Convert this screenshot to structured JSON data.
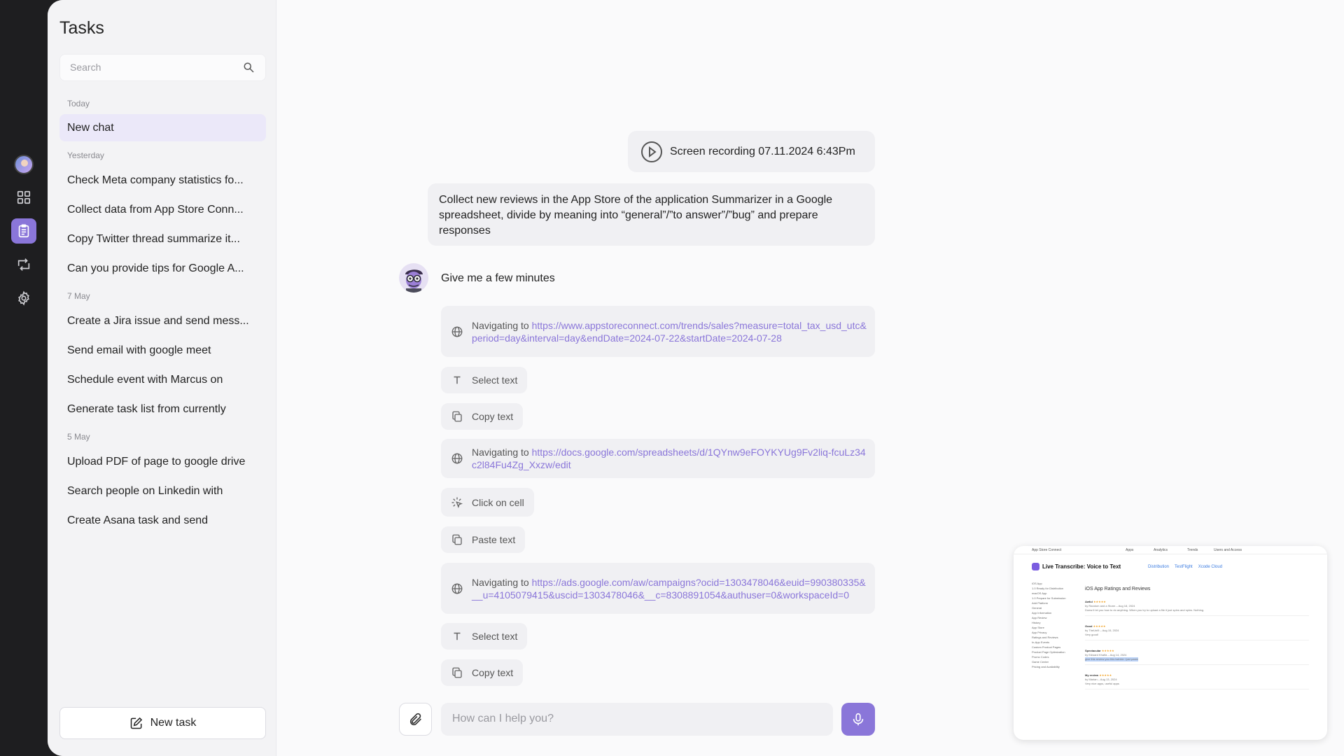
{
  "sidebar": {
    "title": "Tasks",
    "search_placeholder": "Search",
    "sections": [
      {
        "label": "Today",
        "items": [
          "New chat"
        ]
      },
      {
        "label": "Yesterday",
        "items": [
          "Check Meta company statistics fo...",
          "Collect data from App Store Conn...",
          "Copy Twitter thread summarize it...",
          "Can you provide tips for Google A..."
        ]
      },
      {
        "label": "7 May",
        "items": [
          "Create a Jira issue and send mess...",
          "Send email with google meet",
          "Schedule event with Marcus on",
          "Generate task list from currently"
        ]
      },
      {
        "label": "5 May",
        "items": [
          "Upload PDF of page to google drive",
          "Search people on Linkedin with",
          "Create Asana task and send"
        ]
      }
    ],
    "new_task_label": "New task"
  },
  "chat": {
    "recording_label": "Screen recording 07.11.2024 6:43Pm",
    "user_message": "Collect new reviews in the App Store of the application Summarizer in a Google spreadsheet, divide by meaning into “general”/”to answer”/”bug” and prepare responses",
    "bot_reply": "Give me a few minutes",
    "steps": [
      {
        "type": "nav",
        "prefix": "Navigating to ",
        "url": "https://www.appstoreconnect.com/trends/sales?measure=total_tax_usd_utc&period=day&interval=day&endDate=2024-07-22&startDate=2024-07-28",
        "icon": "globe-icon"
      },
      {
        "type": "action",
        "label": "Select text",
        "icon": "text-icon"
      },
      {
        "type": "action",
        "label": "Copy text",
        "icon": "copy-icon"
      },
      {
        "type": "nav",
        "prefix": "Navigating to ",
        "url": "https://docs.google.com/spreadsheets/d/1QYnw9eFOYKYUg9Fv2liq-fcuLz34c2l84Fu4Zg_Xxzw/edit",
        "icon": "globe-icon"
      },
      {
        "type": "action",
        "label": "Click on cell",
        "icon": "click-icon"
      },
      {
        "type": "action",
        "label": "Paste text",
        "icon": "copy-icon"
      },
      {
        "type": "nav",
        "prefix": "Navigating to ",
        "url": "https://ads.google.com/aw/campaigns?ocid=1303478046&euid=990380335&__u=4105079415&uscid=1303478046&__c=8308891054&authuser=0&workspaceId=0",
        "icon": "globe-icon"
      },
      {
        "type": "action",
        "label": "Select text",
        "icon": "text-icon"
      },
      {
        "type": "action",
        "label": "Copy text",
        "icon": "copy-icon"
      }
    ],
    "input_placeholder": "How can I help you?"
  },
  "preview": {
    "top_brand": "App Store Connect",
    "top_links": [
      "Apps",
      "Analytics",
      "Trends",
      "Users and Access"
    ],
    "app_title": "Live Transcribe: Voice to Text",
    "tabs": [
      "Distribution",
      "TestFlight",
      "Xcode Cloud"
    ],
    "section_heading": "iOS App Ratings and Reviews",
    "side_items": [
      "iOS App",
      "1.0 Ready for Distribution",
      "macOS App",
      "1.0 Prepare for Submission",
      "Add Platform",
      "General",
      "App Information",
      "App Review",
      "History",
      "App Store",
      "App Privacy",
      "Ratings and Reviews",
      "In-App Events",
      "Custom Product Pages",
      "Product Page Optimization",
      "Promo Codes",
      "Game Center",
      "Pricing and Availability"
    ],
    "reviews": [
      {
        "title": "Awful",
        "stars": "★★★★★",
        "meta": "by Random and a Storm – Aug 18, 2024",
        "body": "Doesn't let you how to do anything. When you try to upload a file it just spins and spins. Nothing."
      },
      {
        "title": "Good",
        "stars": "★★★★★",
        "meta": "by TheUni9 – Aug 15, 2024",
        "body": "Very good!"
      },
      {
        "title": "Spectacular",
        "stars": "★★★★★",
        "meta": "by Edward Khalfa – Aug 14, 2024",
        "body": "give this review you this twinkle i just paste"
      },
      {
        "title": "My review",
        "stars": "★★★★★",
        "meta": "by Marian – Aug 13, 2024",
        "body": "Very nice apps, useful apps"
      }
    ]
  }
}
